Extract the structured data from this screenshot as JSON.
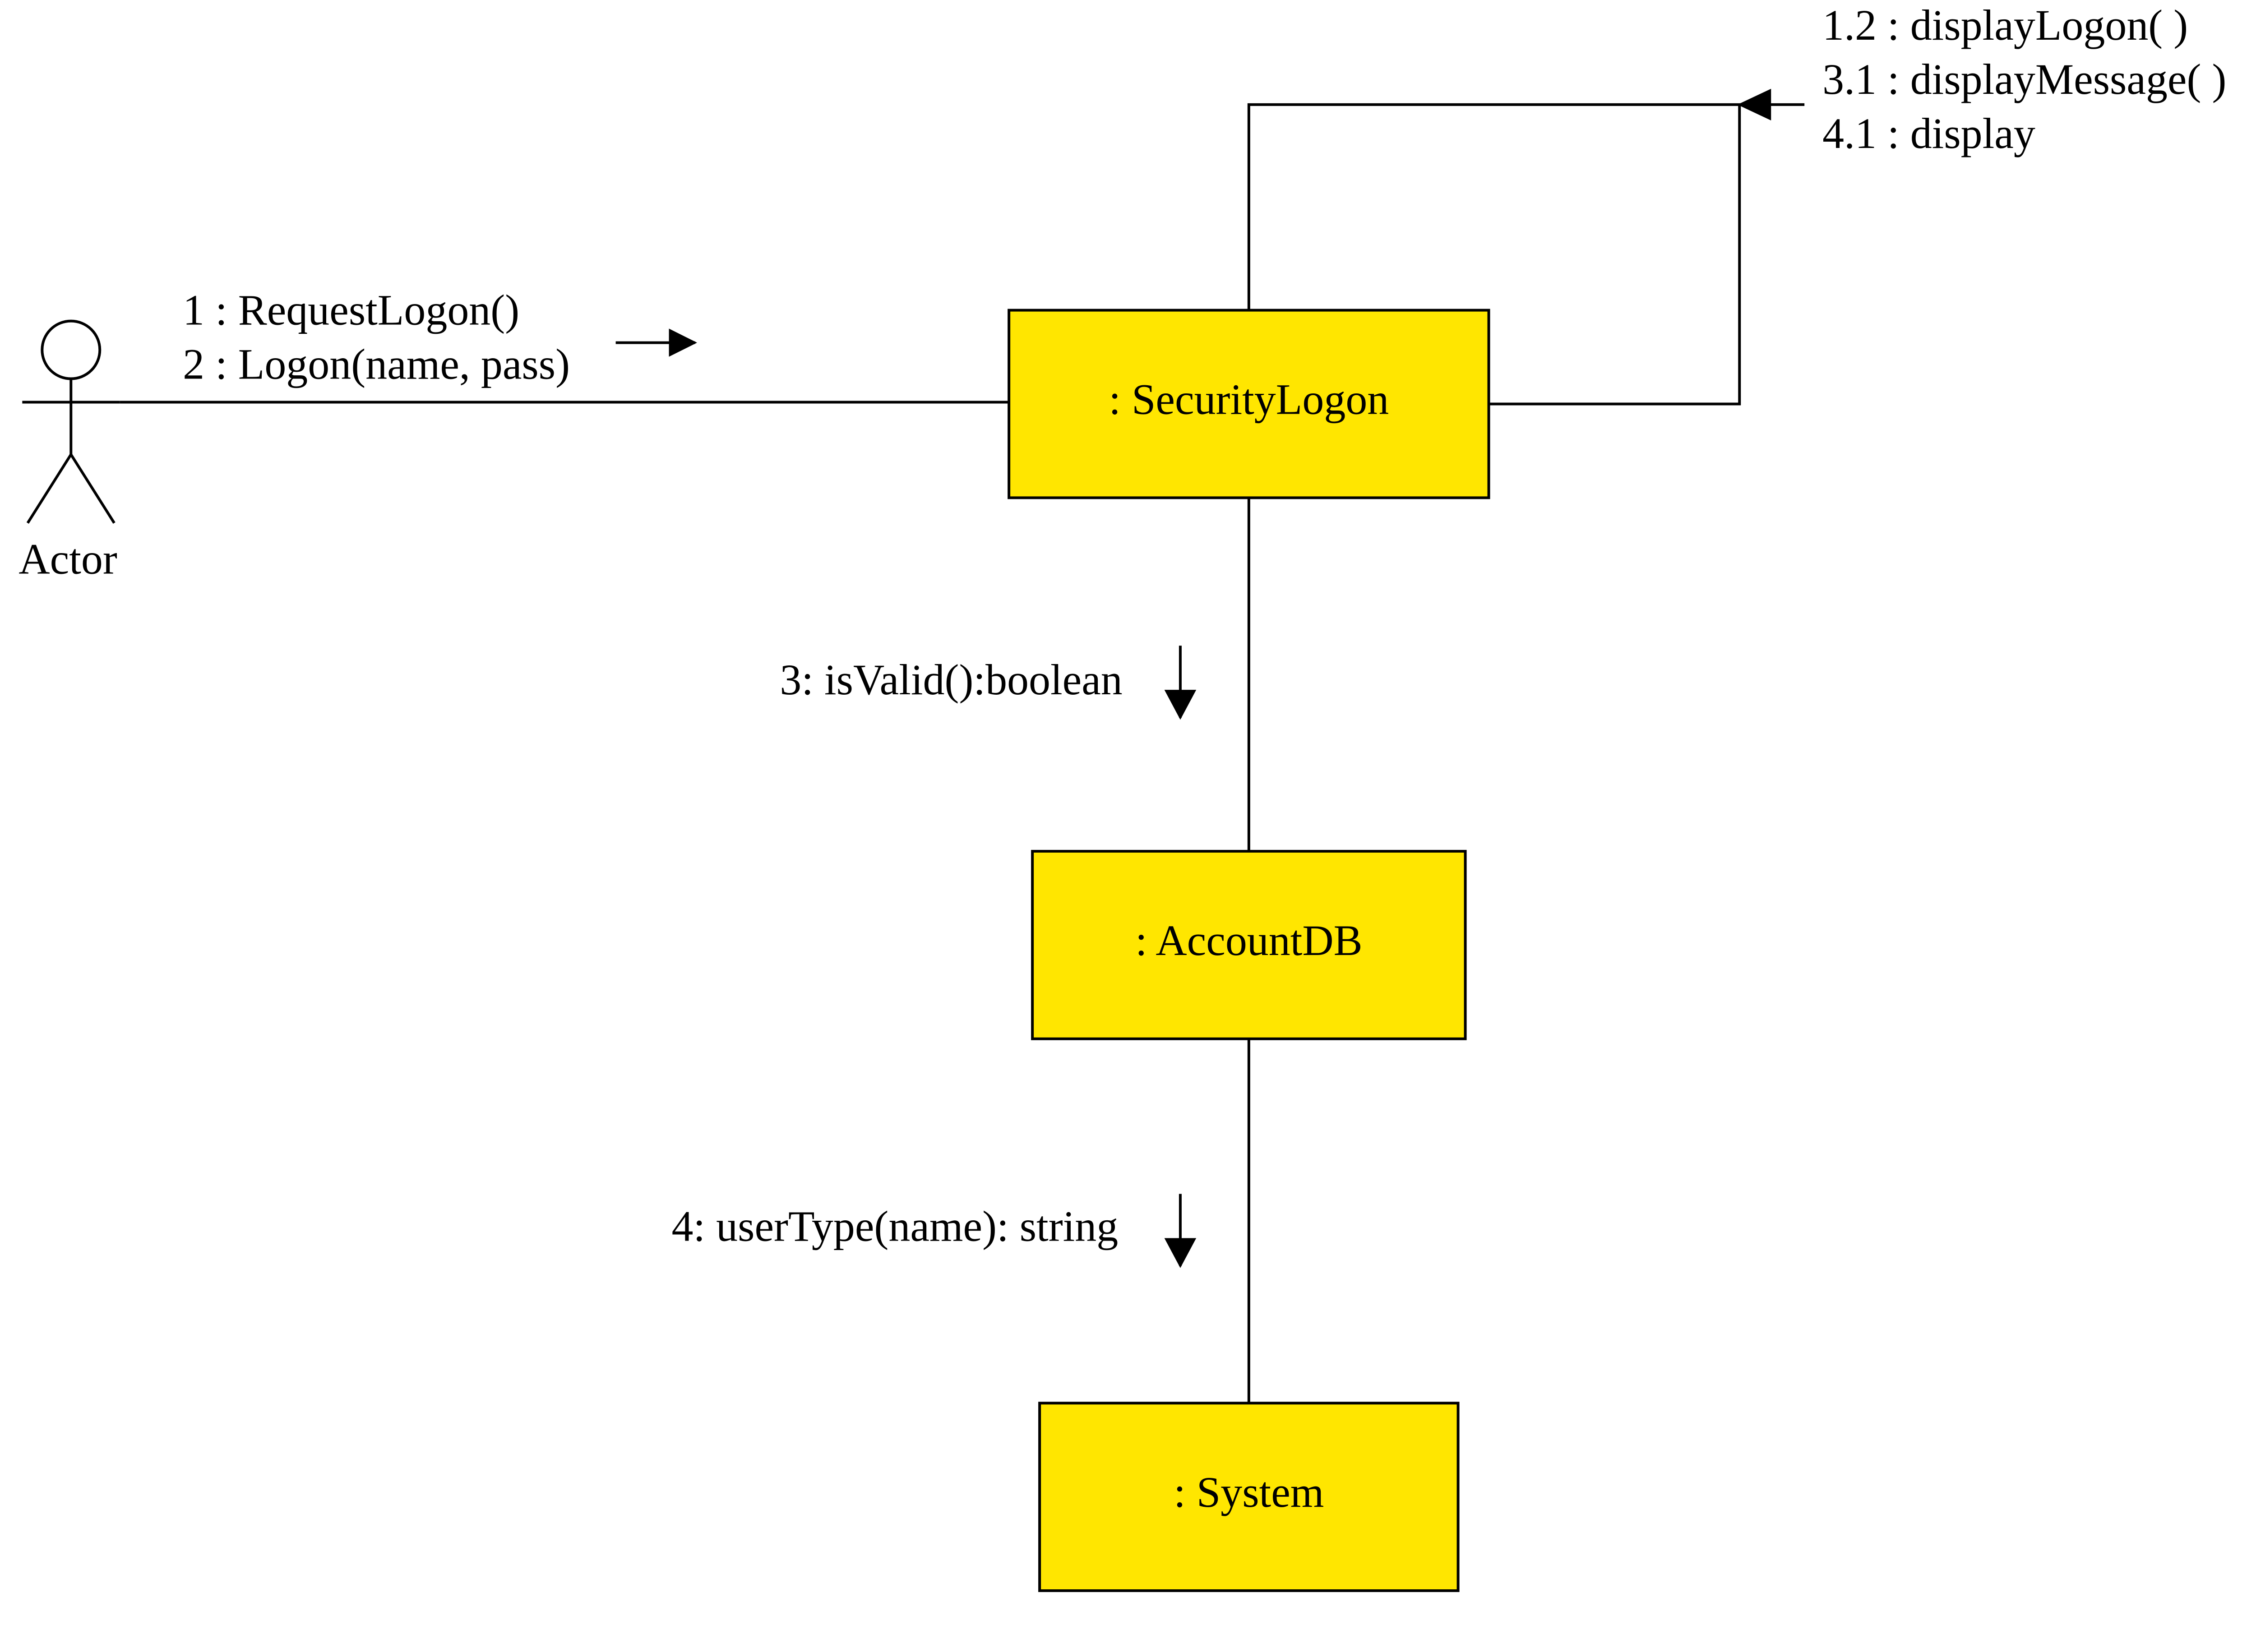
{
  "actor": {
    "label": "Actor"
  },
  "boxes": {
    "securityLogon": ": SecurityLogon",
    "accountDB": ": AccountDB",
    "system": ": System"
  },
  "messages": {
    "m1": "1 : RequestLogon()",
    "m2": "2 : Logon(name, pass)",
    "m3": "3: isValid():boolean",
    "m4": "4: userType(name): string",
    "self12": "1.2 : displayLogon( )",
    "self31": "3.1 : displayMessage( )",
    "self41": "4.1 : display"
  }
}
